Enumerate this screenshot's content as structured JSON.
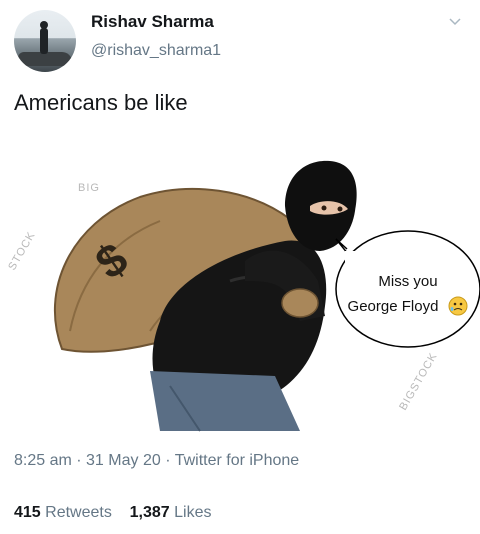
{
  "user": {
    "display_name": "Rishav Sharma",
    "handle": "@rishav_sharma1"
  },
  "tweet": {
    "text": "Americans be like"
  },
  "image": {
    "bubble_line1": "Miss you",
    "bubble_line2": "George Floyd",
    "bubble_emoji": "🥲",
    "watermark": "BIGSTOCK"
  },
  "meta": {
    "time": "8:25 am",
    "sep1": " · ",
    "date": "31 May 20",
    "sep2": " · ",
    "source": "Twitter for iPhone"
  },
  "stats": {
    "retweets_count": "415",
    "retweets_label": "Retweets",
    "likes_count": "1,387",
    "likes_label": "Likes"
  },
  "icons": [
    "avatar",
    "chevron-down-icon"
  ]
}
